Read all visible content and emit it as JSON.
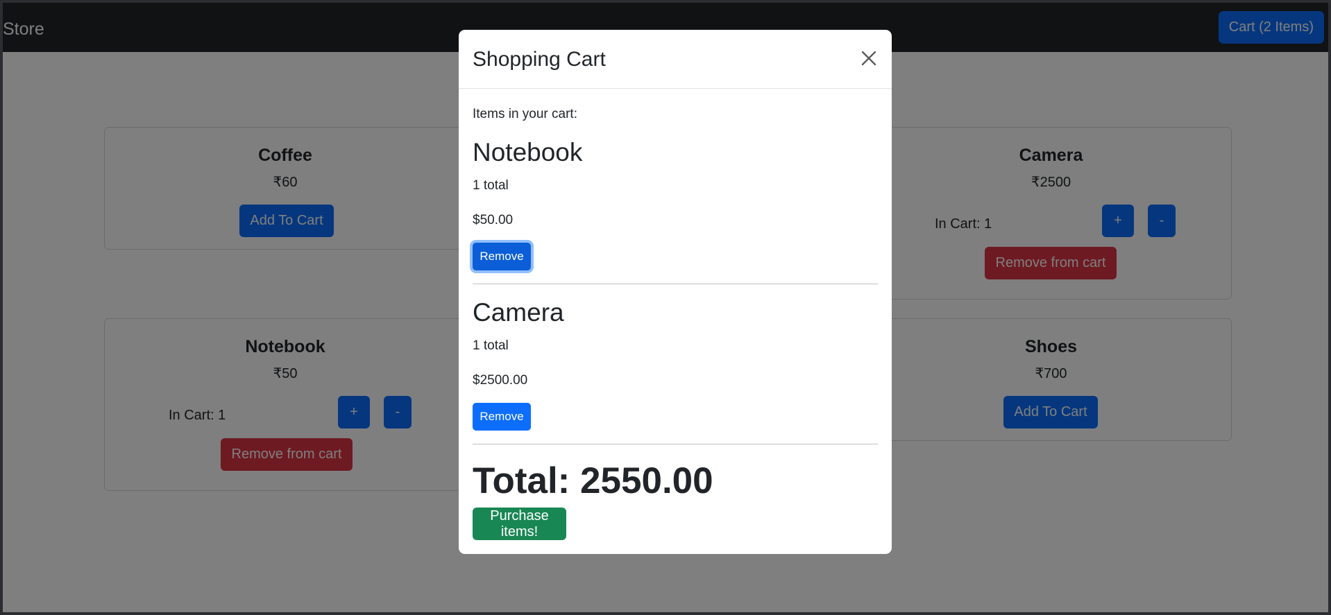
{
  "navbar": {
    "brand": "Store",
    "cart_button": "Cart (2 Items)"
  },
  "products": [
    {
      "name": "Coffee",
      "price": "₹60",
      "add_label": "Add To Cart"
    },
    {
      "name": "Camera",
      "price": "₹2500",
      "in_cart": "In Cart: 1",
      "plus": "+",
      "minus": "-",
      "remove_label": "Remove from cart"
    },
    {
      "name": "Notebook",
      "price": "₹50",
      "in_cart": "In Cart: 1",
      "plus": "+",
      "minus": "-",
      "remove_label": "Remove from cart"
    },
    {
      "name": "Shoes",
      "price": "₹700",
      "add_label": "Add To Cart"
    }
  ],
  "modal": {
    "title": "Shopping Cart",
    "intro": "Items in your cart:",
    "items": [
      {
        "name": "Notebook",
        "quantity": "1 total",
        "price": "$50.00",
        "remove_label": "Remove"
      },
      {
        "name": "Camera",
        "quantity": "1 total",
        "price": "$2500.00",
        "remove_label": "Remove"
      }
    ],
    "total": "Total: 2550.00",
    "purchase_label": "Purchase items!"
  },
  "colors": {
    "primary": "#0d6efd",
    "danger": "#dc3545",
    "success": "#198754",
    "navbar": "#212529"
  }
}
